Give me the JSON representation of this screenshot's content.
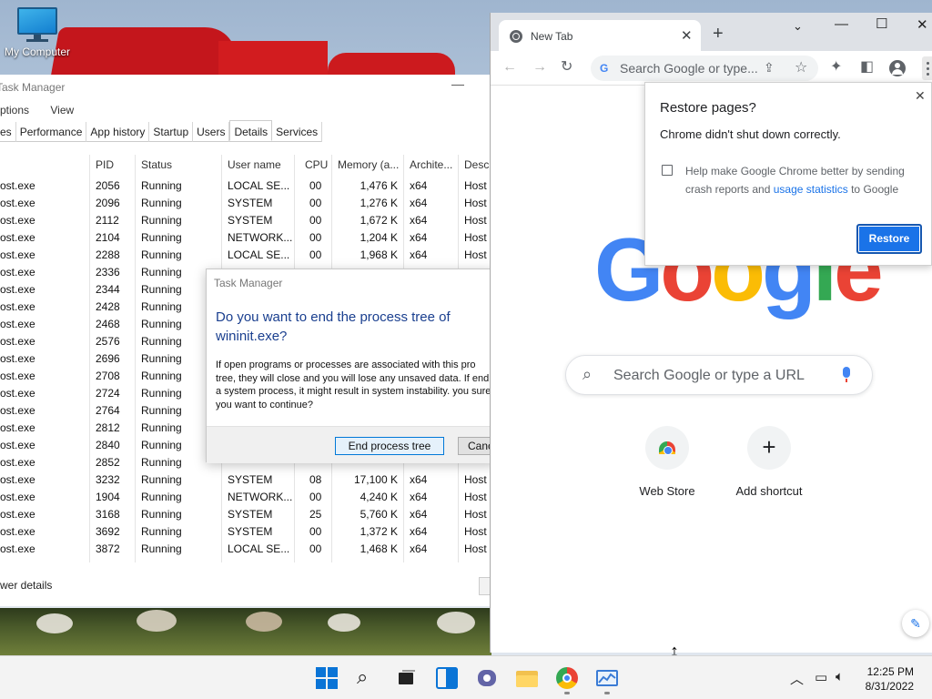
{
  "desktop": {
    "icon_label": "My Computer"
  },
  "task_manager": {
    "title": "Task Manager",
    "menu": [
      "ptions",
      "View"
    ],
    "tabs": [
      "es",
      "Performance",
      "App history",
      "Startup",
      "Users",
      "Details",
      "Services"
    ],
    "active_tab": "Details",
    "columns": [
      "",
      "PID",
      "Status",
      "User name",
      "CPU",
      "Memory (a...",
      "Archite...",
      "Descr"
    ],
    "rows": [
      [
        "ost.exe",
        "2056",
        "Running",
        "LOCAL SE...",
        "00",
        "1,476 K",
        "x64",
        "Host"
      ],
      [
        "ost.exe",
        "2096",
        "Running",
        "SYSTEM",
        "00",
        "1,276 K",
        "x64",
        "Host"
      ],
      [
        "ost.exe",
        "2112",
        "Running",
        "SYSTEM",
        "00",
        "1,672 K",
        "x64",
        "Host"
      ],
      [
        "ost.exe",
        "2104",
        "Running",
        "NETWORK...",
        "00",
        "1,204 K",
        "x64",
        "Host"
      ],
      [
        "ost.exe",
        "2288",
        "Running",
        "LOCAL SE...",
        "00",
        "1,968 K",
        "x64",
        "Host"
      ],
      [
        "ost.exe",
        "2336",
        "Running",
        "",
        "",
        "",
        "",
        ""
      ],
      [
        "ost.exe",
        "2344",
        "Running",
        "",
        "",
        "",
        "",
        ""
      ],
      [
        "ost.exe",
        "2428",
        "Running",
        "",
        "",
        "",
        "",
        ""
      ],
      [
        "ost.exe",
        "2468",
        "Running",
        "",
        "",
        "",
        "",
        ""
      ],
      [
        "ost.exe",
        "2576",
        "Running",
        "",
        "",
        "",
        "",
        ""
      ],
      [
        "ost.exe",
        "2696",
        "Running",
        "",
        "",
        "",
        "",
        ""
      ],
      [
        "ost.exe",
        "2708",
        "Running",
        "",
        "",
        "",
        "",
        ""
      ],
      [
        "ost.exe",
        "2724",
        "Running",
        "",
        "",
        "",
        "",
        ""
      ],
      [
        "ost.exe",
        "2764",
        "Running",
        "",
        "",
        "",
        "",
        ""
      ],
      [
        "ost.exe",
        "2812",
        "Running",
        "",
        "",
        "",
        "",
        ""
      ],
      [
        "ost.exe",
        "2840",
        "Running",
        "",
        "",
        "",
        "",
        ""
      ],
      [
        "ost.exe",
        "2852",
        "Running",
        "",
        "",
        "",
        "",
        ""
      ],
      [
        "ost.exe",
        "3232",
        "Running",
        "SYSTEM",
        "08",
        "17,100 K",
        "x64",
        "Host"
      ],
      [
        "ost.exe",
        "1904",
        "Running",
        "NETWORK...",
        "00",
        "4,240 K",
        "x64",
        "Host"
      ],
      [
        "ost.exe",
        "3168",
        "Running",
        "SYSTEM",
        "25",
        "5,760 K",
        "x64",
        "Host"
      ],
      [
        "ost.exe",
        "3692",
        "Running",
        "SYSTEM",
        "00",
        "1,372 K",
        "x64",
        "Host"
      ],
      [
        "ost.exe",
        "3872",
        "Running",
        "LOCAL SE...",
        "00",
        "1,468 K",
        "x64",
        "Host"
      ]
    ],
    "footer": "wer details"
  },
  "dialog": {
    "title": "Task Manager",
    "heading": "Do you want to end the process tree of wininit.exe?",
    "body": "If open programs or processes are associated with this pro tree, they will close and you will lose any unsaved data. If end a system process, it might result in system instability. you sure you want to continue?",
    "primary_button": "End process tree",
    "secondary_button": "Canc"
  },
  "chrome": {
    "tab_title": "New Tab",
    "omnibox_placeholder": "Search Google or type...",
    "google_letters": [
      "G",
      "o",
      "o",
      "g",
      "l",
      "e"
    ],
    "google_colors": [
      "#4285f4",
      "#ea4335",
      "#fbbc05",
      "#4285f4",
      "#34a853",
      "#ea4335"
    ],
    "search_placeholder": "Search Google or type a URL",
    "shortcuts": [
      "Web Store",
      "Add shortcut"
    ],
    "restore": {
      "title": "Restore pages?",
      "subtitle": "Chrome didn't shut down correctly.",
      "help_text_1": "Help make Google Chrome better by sending crash reports and ",
      "help_link": "usage statistics",
      "help_text_2": " to Google",
      "button": "Restore"
    }
  },
  "taskbar": {
    "time": "12:25 PM",
    "date": "8/31/2022"
  }
}
